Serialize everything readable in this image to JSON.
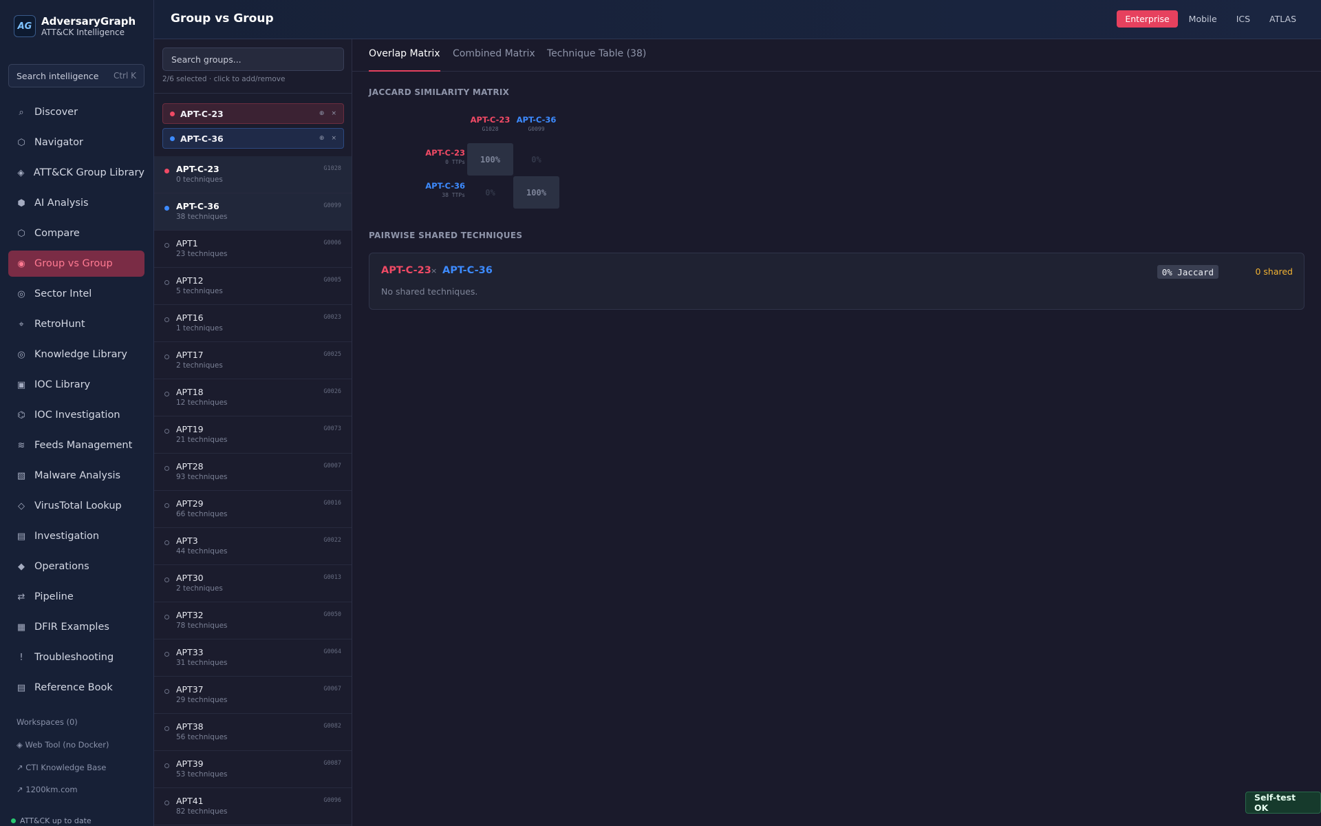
{
  "app": {
    "name": "AdversaryGraph",
    "subtitle": "ATT&CK Intelligence",
    "logo_text": "AG"
  },
  "sidebar": {
    "search": {
      "label": "Search intelligence",
      "shortcut": "Ctrl K"
    },
    "items": [
      {
        "label": "Discover",
        "icon": "⌕",
        "icon_name": "search-icon"
      },
      {
        "label": "Navigator",
        "icon": "⬡",
        "icon_name": "hexagon-icon"
      },
      {
        "label": "ATT&CK Group Library",
        "icon": "◈",
        "icon_name": "diamond-icon"
      },
      {
        "label": "AI Analysis",
        "icon": "⬢",
        "icon_name": "ai-icon"
      },
      {
        "label": "Compare",
        "icon": "⬡",
        "icon_name": "compare-icon"
      },
      {
        "label": "Group vs Group",
        "icon": "◉",
        "icon_name": "target-icon",
        "active": true
      },
      {
        "label": "Sector Intel",
        "icon": "◎",
        "icon_name": "sector-icon"
      },
      {
        "label": "RetroHunt",
        "icon": "⌖",
        "icon_name": "hunt-icon"
      },
      {
        "label": "Knowledge Library",
        "icon": "◎",
        "icon_name": "library-icon"
      },
      {
        "label": "IOC Library",
        "icon": "▣",
        "icon_name": "ioc-icon"
      },
      {
        "label": "IOC Investigation",
        "icon": "⌬",
        "icon_name": "investigate-icon"
      },
      {
        "label": "Feeds Management",
        "icon": "≋",
        "icon_name": "feed-icon"
      },
      {
        "label": "Malware Analysis",
        "icon": "▧",
        "icon_name": "malware-icon"
      },
      {
        "label": "VirusTotal Lookup",
        "icon": "◇",
        "icon_name": "virustotal-icon"
      },
      {
        "label": "Investigation",
        "icon": "▤",
        "icon_name": "investigation-icon"
      },
      {
        "label": "Operations",
        "icon": "◆",
        "icon_name": "operations-icon"
      },
      {
        "label": "Pipeline",
        "icon": "⇄",
        "icon_name": "pipeline-icon"
      },
      {
        "label": "DFIR Examples",
        "icon": "▦",
        "icon_name": "dfir-icon"
      },
      {
        "label": "Troubleshooting",
        "icon": "!",
        "icon_name": "alert-icon"
      },
      {
        "label": "Reference Book",
        "icon": "▤",
        "icon_name": "book-icon"
      }
    ],
    "workspaces": "Workspaces (0)",
    "links": [
      "◈ Web Tool (no Docker)",
      "↗ CTI Knowledge Base",
      "↗ 1200km.com"
    ],
    "status": "ATT&CK up to date"
  },
  "header": {
    "title": "Group vs Group",
    "domains": [
      "Enterprise",
      "Mobile",
      "ICS",
      "ATLAS"
    ],
    "active_domain": "Enterprise"
  },
  "group_panel": {
    "search_placeholder": "Search groups...",
    "selection_hint": "2/6 selected · click to add/remove",
    "chip_actions": [
      "⊕",
      "×"
    ],
    "selected": [
      {
        "name": "APT-C-23",
        "color": "#f04a65"
      },
      {
        "name": "APT-C-36",
        "color": "#3d8bff"
      }
    ],
    "groups": [
      {
        "name": "APT-C-23",
        "techniques": "0 techniques",
        "id": "G1028",
        "selected": "red"
      },
      {
        "name": "APT-C-36",
        "techniques": "38 techniques",
        "id": "G0099",
        "selected": "blue"
      },
      {
        "name": "APT1",
        "techniques": "23 techniques",
        "id": "G0006"
      },
      {
        "name": "APT12",
        "techniques": "5 techniques",
        "id": "G0005"
      },
      {
        "name": "APT16",
        "techniques": "1 techniques",
        "id": "G0023"
      },
      {
        "name": "APT17",
        "techniques": "2 techniques",
        "id": "G0025"
      },
      {
        "name": "APT18",
        "techniques": "12 techniques",
        "id": "G0026"
      },
      {
        "name": "APT19",
        "techniques": "21 techniques",
        "id": "G0073"
      },
      {
        "name": "APT28",
        "techniques": "93 techniques",
        "id": "G0007"
      },
      {
        "name": "APT29",
        "techniques": "66 techniques",
        "id": "G0016"
      },
      {
        "name": "APT3",
        "techniques": "44 techniques",
        "id": "G0022"
      },
      {
        "name": "APT30",
        "techniques": "2 techniques",
        "id": "G0013"
      },
      {
        "name": "APT32",
        "techniques": "78 techniques",
        "id": "G0050"
      },
      {
        "name": "APT33",
        "techniques": "31 techniques",
        "id": "G0064"
      },
      {
        "name": "APT37",
        "techniques": "29 techniques",
        "id": "G0067"
      },
      {
        "name": "APT38",
        "techniques": "56 techniques",
        "id": "G0082"
      },
      {
        "name": "APT39",
        "techniques": "53 techniques",
        "id": "G0087"
      },
      {
        "name": "APT41",
        "techniques": "82 techniques",
        "id": "G0096"
      }
    ]
  },
  "main": {
    "tabs": [
      "Overlap Matrix",
      "Combined Matrix",
      "Technique Table (38)"
    ],
    "active_tab": "Overlap Matrix",
    "matrix": {
      "title": "JACCARD SIMILARITY MATRIX",
      "columns": [
        {
          "name": "APT-C-23",
          "id": "G1028"
        },
        {
          "name": "APT-C-36",
          "id": "G0099"
        }
      ],
      "rows": [
        {
          "name": "APT-C-23",
          "ttps": "0 TTPs",
          "cells": [
            "100%",
            "0%"
          ]
        },
        {
          "name": "APT-C-36",
          "ttps": "38 TTPs",
          "cells": [
            "0%",
            "100%"
          ]
        }
      ]
    },
    "pairwise": {
      "title": "PAIRWISE SHARED TECHNIQUES",
      "group_a": "APT-C-23",
      "separator": "×",
      "group_b": "APT-C-36",
      "jaccard": "0% Jaccard",
      "shared": "0 shared",
      "empty_text": "No shared techniques."
    }
  },
  "self_test": "Self-test OK",
  "colors": {
    "accent": "#e6415e",
    "group_a": "#f04a65",
    "group_b": "#3d8bff",
    "shared": "#f2b332",
    "ok": "#28c76f"
  }
}
